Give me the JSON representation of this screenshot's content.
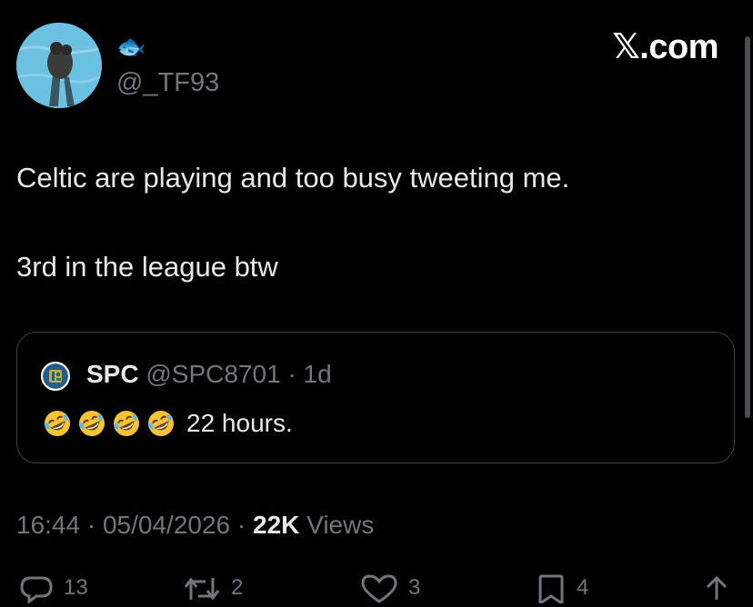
{
  "profile": {
    "avatar_icon": "profile-photo-swimmer-in-pool",
    "display_name_emoji": "🐟",
    "handle": "@_TF93"
  },
  "brand": {
    "label": "𝕏.com",
    "color": "#ffffff"
  },
  "tweet": {
    "lines": [
      "Celtic are playing and too busy tweeting me.",
      "3rd in the league btw"
    ]
  },
  "quote": {
    "avatar_icon": "club-crest-avatar",
    "name": "SPC",
    "handle": "@SPC8701",
    "separator": "·",
    "time": "1d",
    "emojis": [
      "🤣",
      "🤣",
      "🤣",
      "🤣"
    ],
    "emoji_icon": "rolling-on-floor-laughing-emoji",
    "text": "22 hours."
  },
  "meta": {
    "time": "16:44",
    "separator": "·",
    "date": "05/04/2026",
    "views_count": "22K",
    "views_label": "Views"
  },
  "actions": {
    "replies": "13",
    "reposts": "2",
    "likes": "3",
    "bookmarks": "4"
  },
  "colors": {
    "background": "#000000",
    "text": "#e7e9ea",
    "secondary": "#71767b",
    "border": "#3e4144"
  }
}
